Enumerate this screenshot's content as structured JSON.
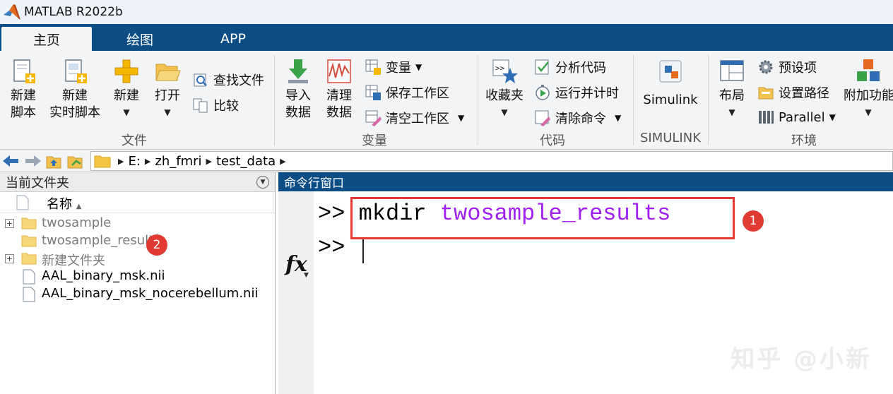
{
  "window": {
    "title": "MATLAB R2022b",
    "logo_icon": "matlab-logo-icon"
  },
  "tabs": [
    {
      "label": "主页",
      "active": true
    },
    {
      "label": "绘图",
      "active": false
    },
    {
      "label": "APP",
      "active": false
    }
  ],
  "ribbon": {
    "file_group": {
      "label": "文件",
      "new_script": "新建\n脚本",
      "new_live_script": "新建\n实时脚本",
      "new": "新建",
      "open": "打开",
      "find_files": "查找文件",
      "compare": "比较"
    },
    "variable_group": {
      "label": "变量",
      "import_data": "导入\n数据",
      "clean_data": "清理\n数据",
      "variable": "变量",
      "save_workspace": "保存工作区",
      "clear_workspace": "清空工作区"
    },
    "code_group": {
      "label": "代码",
      "favorites": "收藏夹",
      "analyze_code": "分析代码",
      "run_and_time": "运行并计时",
      "clear_commands": "清除命令"
    },
    "simulink_group": {
      "label": "SIMULINK",
      "simulink": "Simulink"
    },
    "environment_group": {
      "label": "环境",
      "layout": "布局",
      "preferences": "预设项",
      "set_path": "设置路径",
      "parallel": "Parallel",
      "addons": "附加功能"
    }
  },
  "address_bar": {
    "path": [
      "E:",
      "zh_fmri",
      "test_data"
    ]
  },
  "current_folder": {
    "title": "当前文件夹",
    "column_name": "名称",
    "items": [
      {
        "name": "twosample",
        "type": "folder",
        "expandable": true,
        "dim": true
      },
      {
        "name": "twosample_results",
        "type": "folder",
        "expandable": false,
        "dim": true
      },
      {
        "name": "新建文件夹",
        "type": "folder",
        "expandable": true,
        "dim": true
      },
      {
        "name": "AAL_binary_msk.nii",
        "type": "file",
        "expandable": false,
        "dim": false
      },
      {
        "name": "AAL_binary_msk_nocerebellum.nii",
        "type": "file",
        "expandable": false,
        "dim": false
      }
    ]
  },
  "command_window": {
    "title": "命令行窗口",
    "prompt": ">>",
    "command": "mkdir",
    "argument": "twosample_results",
    "fx_label": "fx"
  },
  "annotations": {
    "badge1": "1",
    "badge2": "2"
  },
  "watermark": "知乎 @小新",
  "colors": {
    "accent_blue": "#0c4d86",
    "annotation_red": "#e03a33",
    "string_purple": "#a020f0"
  }
}
